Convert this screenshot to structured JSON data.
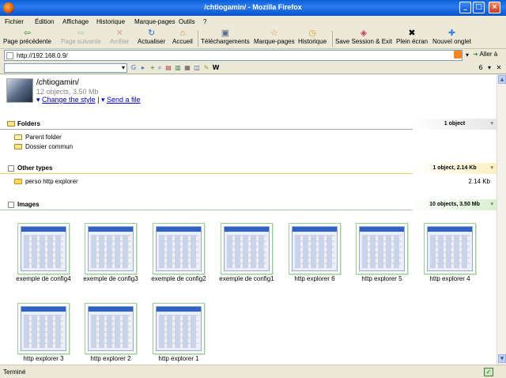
{
  "window": {
    "title": "/chtiogamin/ - Mozilla Firefox"
  },
  "menu": [
    "Fichier",
    "Édition",
    "Affichage",
    "Historique",
    "Marque-pages",
    "Outils",
    "?"
  ],
  "toolbar": {
    "back": "Page précédente",
    "forward": "Page suivante",
    "stop": "Arrêter",
    "reload": "Actualiser",
    "home": "Accueil",
    "downloads": "Téléchargements",
    "bookmarks": "Marque-pages",
    "history": "Historique",
    "save_exit": "Save Session & Exit",
    "fullscreen": "Plein écran",
    "new_tab": "Nouvel onglet"
  },
  "address": {
    "url": "http://192.168.0.9/",
    "go": "Aller à"
  },
  "search": {
    "value": "",
    "counter": "6"
  },
  "profile": {
    "title": "/chtiogamin/",
    "subtitle": "12 objects, 3.50 Mb",
    "change_style": "Change the style",
    "send_file": "Send a file",
    "separator": "|"
  },
  "sections": {
    "folders": {
      "title": "Folders",
      "badge": "1 object"
    },
    "other": {
      "title": "Other types",
      "badge": "1 object, 2.14 Kb"
    },
    "images": {
      "title": "Images",
      "badge": "10 objects, 3.50 Mb"
    }
  },
  "folders": [
    "Parent folder",
    "Dossier commun"
  ],
  "other_files": [
    {
      "name": "perso http explorer",
      "size": "2.14 Kb"
    }
  ],
  "images": [
    "exemple de config4",
    "exemple de config3",
    "exemple de config2",
    "exemple de config1",
    "http explorer 6",
    "http explorer 5",
    "http explorer 4",
    "http explorer 3",
    "http explorer 2",
    "http explorer 1"
  ],
  "status": {
    "text": "Terminé"
  },
  "colors": {
    "folders_line": "#b0b0b0",
    "other_line": "#f0d060",
    "images_line": "#a0d8a0"
  }
}
